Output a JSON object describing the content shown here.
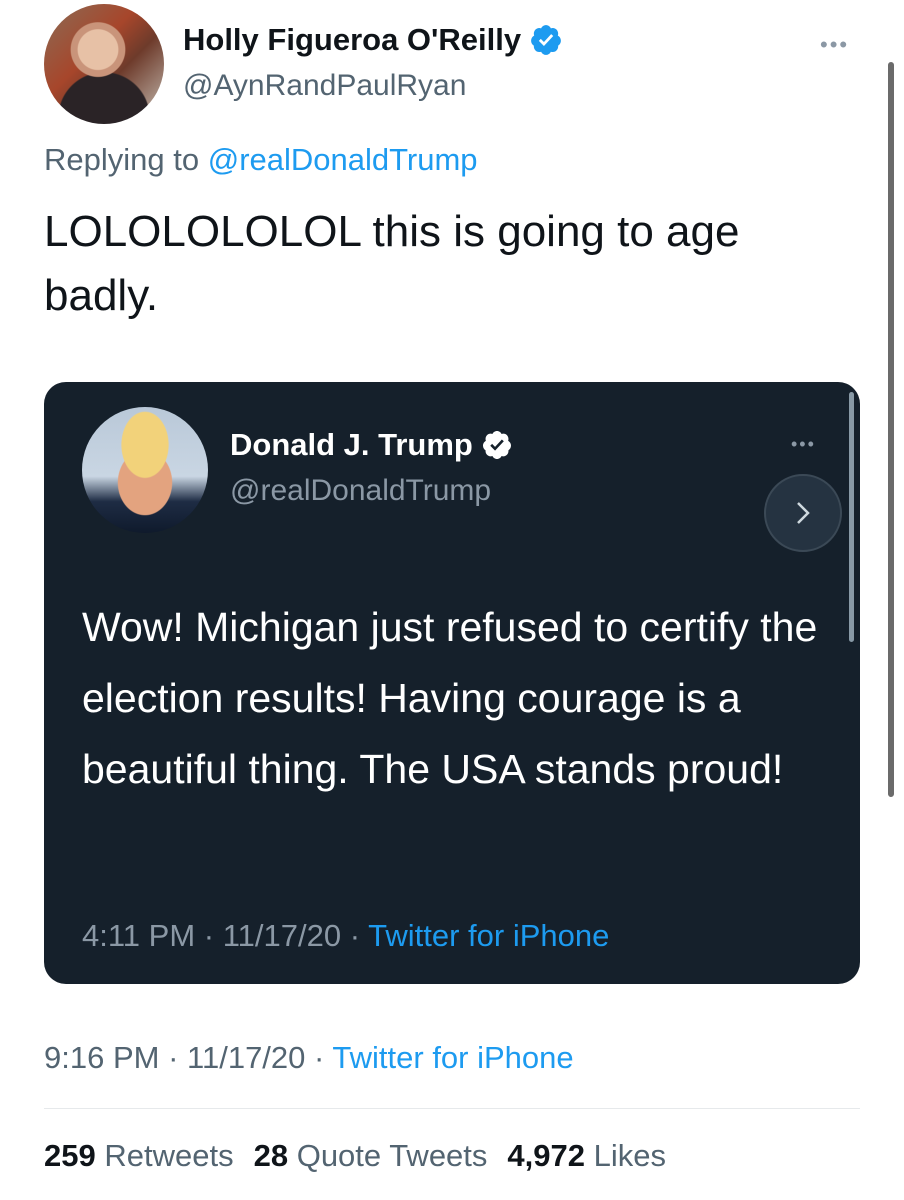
{
  "author": {
    "display_name": "Holly Figueroa O'Reilly",
    "handle": "@AynRandPaulRyan",
    "verified": true
  },
  "reply": {
    "prefix": "Replying to",
    "mention": "@realDonaldTrump"
  },
  "tweet": {
    "text": "LOLOLOLOLOL this is going to age badly."
  },
  "quoted": {
    "display_name": "Donald J. Trump",
    "handle": "@realDonaldTrump",
    "verified": true,
    "text": "Wow! Michigan just refused to certify the election results! Having courage is a beautiful thing. The USA stands proud!",
    "time": "4:11 PM",
    "date": "11/17/20",
    "source": "Twitter for iPhone"
  },
  "meta": {
    "time": "9:16 PM",
    "date": "11/17/20",
    "source": "Twitter for iPhone",
    "separator": "·"
  },
  "stats": {
    "retweets_count": "259",
    "retweets_label": "Retweets",
    "quotes_count": "28",
    "quotes_label": "Quote Tweets",
    "likes_count": "4,972",
    "likes_label": "Likes"
  },
  "icons": {
    "verified": "verified-badge-icon",
    "more": "more-options-icon",
    "chevron": "chevron-right-icon"
  },
  "colors": {
    "accent": "#1d9bf0",
    "embed_background": "#15202b",
    "secondary_text": "#536471"
  }
}
